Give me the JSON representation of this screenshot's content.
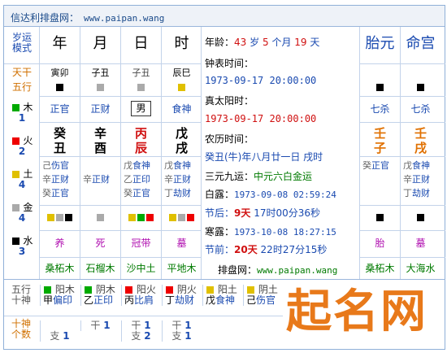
{
  "header": {
    "title": "信达利排盘网：",
    "url": "www.paipan.wang"
  },
  "left_col": {
    "mode": "岁运\n模式",
    "gan": "天干",
    "xing": "五行"
  },
  "pillars": [
    {
      "label": "年",
      "branches": "寅卯",
      "shishen": "正官",
      "gan": "癸",
      "zhi": "丑",
      "hidden": [
        "己伤官",
        "辛正财",
        "癸正官"
      ],
      "state": "养",
      "nayin": "桑柘木"
    },
    {
      "label": "月",
      "branches": "子丑",
      "shishen": "正财",
      "gan": "辛",
      "zhi": "酉",
      "hidden": [
        "",
        "辛正财",
        ""
      ],
      "state": "死",
      "nayin": "石榴木"
    },
    {
      "label": "日",
      "branches": "子丑",
      "shishen": "男",
      "gan": "丙",
      "zhi": "辰",
      "hidden": [
        "戊食神",
        "乙正印",
        "癸正官"
      ],
      "state": "冠带",
      "nayin": "沙中土"
    },
    {
      "label": "时",
      "branches": "辰巳",
      "shishen": "食神",
      "gan": "戊",
      "zhi": "戌",
      "hidden": [
        "戊食神",
        "辛正财",
        "丁劫财"
      ],
      "state": "墓",
      "nayin": "平地木"
    }
  ],
  "elements": [
    {
      "name": "木",
      "count": "1",
      "color": "#0a0"
    },
    {
      "name": "火",
      "count": "2",
      "color": "#e00"
    },
    {
      "name": "土",
      "count": "4",
      "color": "#e0c000"
    },
    {
      "name": "金",
      "count": "4",
      "color": "#aaa"
    },
    {
      "name": "水",
      "count": "3",
      "color": "#000"
    }
  ],
  "info": {
    "age_label": "年龄：",
    "age": "43",
    "sui": "岁",
    "months": "5",
    "ge_month": "个月",
    "days": "19",
    "tian": "天",
    "clock_label": "钟表时间：",
    "clock": "1973-09-17 20:00:00",
    "solar_label": "真太阳时：",
    "solar": "1973-09-17 20:00:00",
    "lunar_label": "农历时间：",
    "lunar": "癸丑(牛)年八月廿一日 戌时",
    "yun_label": "三元九运：",
    "yun": "中元六白金运",
    "bailu_label": "白露：",
    "bailu": "1973-09-08 02:59:24",
    "after_label": "节后：",
    "after_days": "9天",
    "after_h": "17时00分36秒",
    "hanlu_label": "寒露：",
    "hanlu": "1973-10-08 18:27:15",
    "before_label": "节前：",
    "before_days": "20天",
    "before_h": "22时27分15秒",
    "site_label": "排盘网：",
    "site": "www.paipan.wang"
  },
  "taiyuan": {
    "label": "胎元",
    "shishen": "七杀",
    "gan": "壬",
    "zhi": "子",
    "hidden": "癸正官",
    "state": "胎",
    "nayin": "桑柘木"
  },
  "minggong": {
    "label": "命宫",
    "shishen": "七杀",
    "gan": "壬",
    "zhi": "戌",
    "hidden": [
      "戊食神",
      "辛正财",
      "丁劫财"
    ],
    "state": "墓",
    "nayin": "大海水"
  },
  "dayun": {
    "row_label": "五行\n十神",
    "count_label": "十神\n个数",
    "items": [
      {
        "xing": "阳木",
        "gan": "甲",
        "shishen": "偏印",
        "color": "#0a0"
      },
      {
        "xing": "阴木",
        "gan": "乙",
        "shishen": "正印",
        "color": "#0a0"
      },
      {
        "xing": "阳火",
        "gan": "丙",
        "shishen": "比肩",
        "color": "#e00"
      },
      {
        "xing": "阴火",
        "gan": "丁",
        "shishen": "劫财",
        "color": "#e00"
      },
      {
        "xing": "阳土",
        "gan": "戊",
        "shishen": "食神",
        "color": "#e0c000"
      },
      {
        "xing": "阴土",
        "gan": "己",
        "shishen": "伤官",
        "color": "#e0c000"
      }
    ],
    "counts": [
      {
        "gan_label": "",
        "zhi_label": "支",
        "zhi_n": "1"
      },
      {
        "gan_label": "干",
        "gan_n": "1",
        "zhi_label": "",
        "zhi_n": ""
      },
      {
        "gan_label": "干",
        "gan_n": "1",
        "zhi_label": "支",
        "zhi_n": "2"
      },
      {
        "gan_label": "干",
        "gan_n": "1",
        "zhi_label": "支",
        "zhi_n": "1"
      }
    ]
  },
  "watermark": "起名网"
}
